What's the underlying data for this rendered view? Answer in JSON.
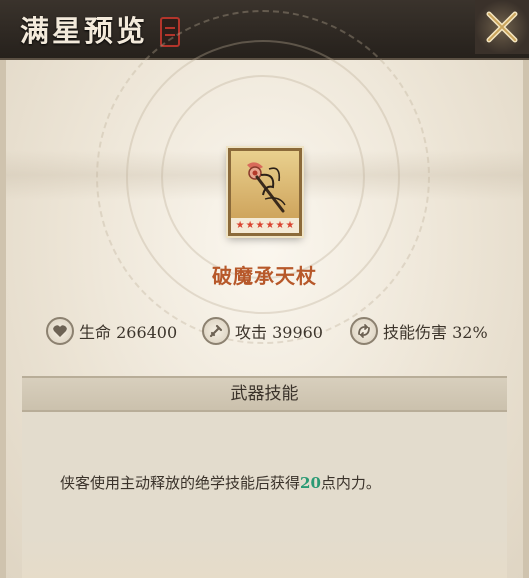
{
  "header": {
    "title": "满星预览"
  },
  "item": {
    "name": "破魔承天杖",
    "star_count": 6,
    "star_glyph": "★"
  },
  "stats": [
    {
      "icon": "heart-icon",
      "label": "生命 266400"
    },
    {
      "icon": "attack-icon",
      "label": "攻击 39960"
    },
    {
      "icon": "skill-damage-icon",
      "label": "技能伤害 32%"
    }
  ],
  "skill": {
    "header": "武器技能",
    "desc_before": "侠客使用主动释放的绝学技能后获得",
    "desc_value": "20",
    "desc_after": "点内力。"
  },
  "colors": {
    "weapon_name": "#b7582a",
    "highlight": "#2a9a74",
    "star": "#d9432e"
  }
}
